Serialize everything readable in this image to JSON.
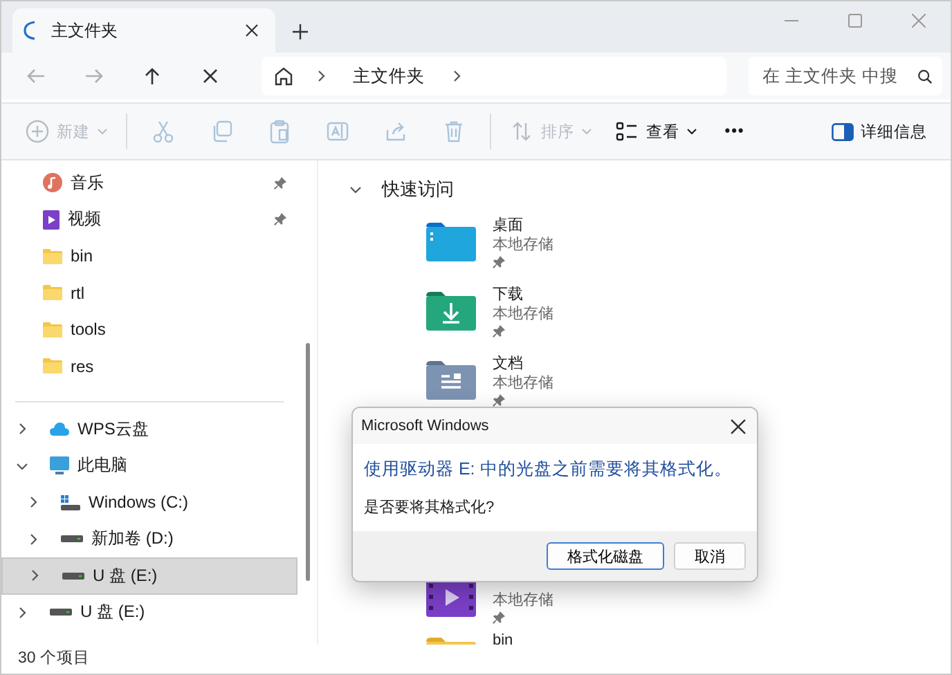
{
  "tab": {
    "title": "主文件夹",
    "loading": true
  },
  "address": {
    "path": [
      "主文件夹"
    ],
    "search_placeholder": "在 主文件夹 中搜"
  },
  "nav": [
    {
      "kind": "back",
      "disabled": true
    },
    {
      "kind": "forward",
      "disabled": true
    },
    {
      "kind": "up",
      "disabled": false
    },
    {
      "kind": "stop",
      "disabled": false
    }
  ],
  "toolbar": [
    {
      "kind": "new",
      "label": "新建",
      "disabled": true
    },
    {
      "kind": "cut",
      "disabled": true
    },
    {
      "kind": "copy",
      "disabled": true
    },
    {
      "kind": "paste",
      "disabled": true
    },
    {
      "kind": "rename",
      "disabled": true
    },
    {
      "kind": "share",
      "disabled": true
    },
    {
      "kind": "delete",
      "disabled": true
    },
    {
      "kind": "sort",
      "label": "排序",
      "disabled": true
    },
    {
      "kind": "view",
      "label": "查看",
      "disabled": false
    },
    {
      "kind": "more",
      "label": "•••",
      "disabled": false
    }
  ],
  "details_button": "详细信息",
  "sidebar": {
    "quick_items": [
      {
        "label": "音乐",
        "kind": "music",
        "pinned": true
      },
      {
        "label": "视频",
        "kind": "video",
        "pinned": true
      },
      {
        "label": "bin",
        "kind": "folder",
        "pinned": false
      },
      {
        "label": "rtl",
        "kind": "folder",
        "pinned": false
      },
      {
        "label": "tools",
        "kind": "folder",
        "pinned": false
      },
      {
        "label": "res",
        "kind": "folder",
        "pinned": false
      }
    ],
    "tree": [
      {
        "label": "WPS云盘",
        "kind": "cloud",
        "expanded": false,
        "selected": false
      },
      {
        "label": "此电脑",
        "kind": "pc",
        "expanded": true,
        "selected": false,
        "children": [
          {
            "label": "Windows (C:)",
            "kind": "sysdrive",
            "expanded": false,
            "selected": false
          },
          {
            "label": "新加卷 (D:)",
            "kind": "drive",
            "expanded": false,
            "selected": false
          },
          {
            "label": "U 盘 (E:)",
            "kind": "drive",
            "expanded": false,
            "selected": true
          }
        ]
      },
      {
        "label": "U 盘 (E:)",
        "kind": "drive",
        "expanded": false,
        "selected": false
      }
    ]
  },
  "content": {
    "section": {
      "title": "快速访问",
      "expanded": true
    },
    "items": [
      {
        "kind": "desktop",
        "name": "桌面",
        "subtitle": "本地存储",
        "pinned": true
      },
      {
        "kind": "download",
        "name": "下载",
        "subtitle": "本地存储",
        "pinned": true
      },
      {
        "kind": "documents",
        "name": "文档",
        "subtitle": "本地存储",
        "pinned": true
      },
      {
        "kind": "video",
        "subtitle": "本地存储",
        "pinned": true
      },
      {
        "kind": "folder",
        "name": "bin"
      }
    ]
  },
  "status_bar": "30 个项目",
  "dialog": {
    "title": "Microsoft Windows",
    "heading": "使用驱动器 E: 中的光盘之前需要将其格式化。",
    "message": "是否要将其格式化?",
    "buttons": [
      {
        "label": "格式化磁盘",
        "default": true
      },
      {
        "label": "取消",
        "default": false
      }
    ]
  }
}
